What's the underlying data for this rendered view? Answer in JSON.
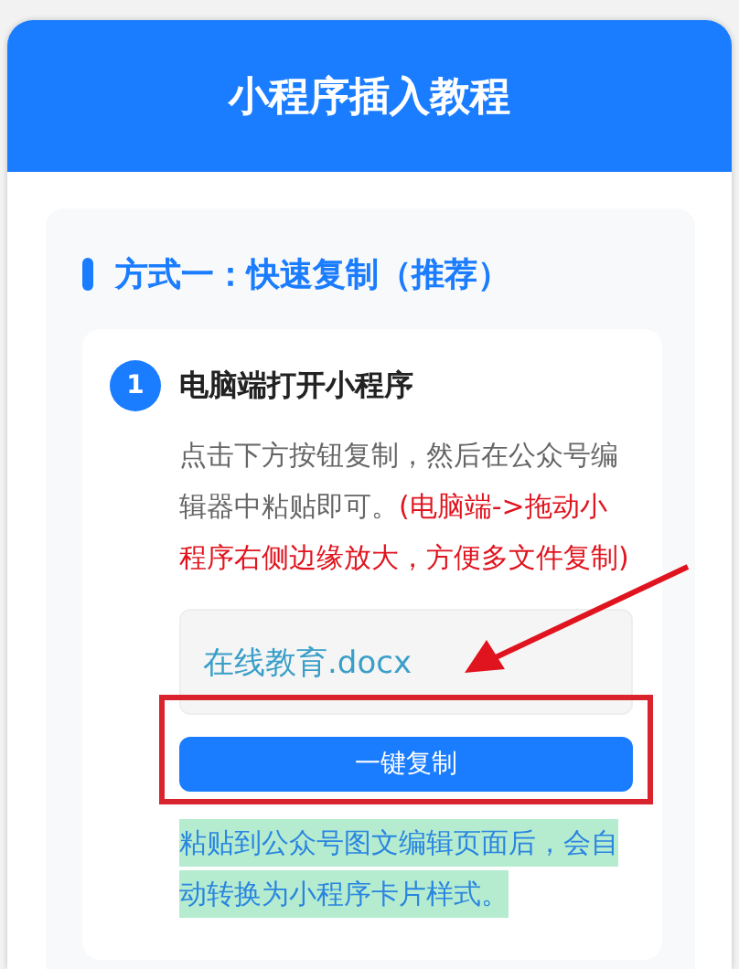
{
  "header": {
    "title": "小程序插入教程"
  },
  "section": {
    "title": "方式一：快速复制（推荐）",
    "steps": [
      {
        "number": "1",
        "title": "电脑端打开小程序",
        "description": "点击下方按钮复制，然后在公众号编辑器中粘贴即可。",
        "warning": "(电脑端->拖动小程序右侧边缘放大，方便多文件复制)",
        "file_name": "在线教育.docx",
        "button": "一键复制",
        "note": "粘贴到公众号图文编辑页面后，会自动转换为小程序卡片样式。",
        "note_highlighted": true
      }
    ]
  },
  "annotations": {
    "arrow": true,
    "frame": true
  }
}
